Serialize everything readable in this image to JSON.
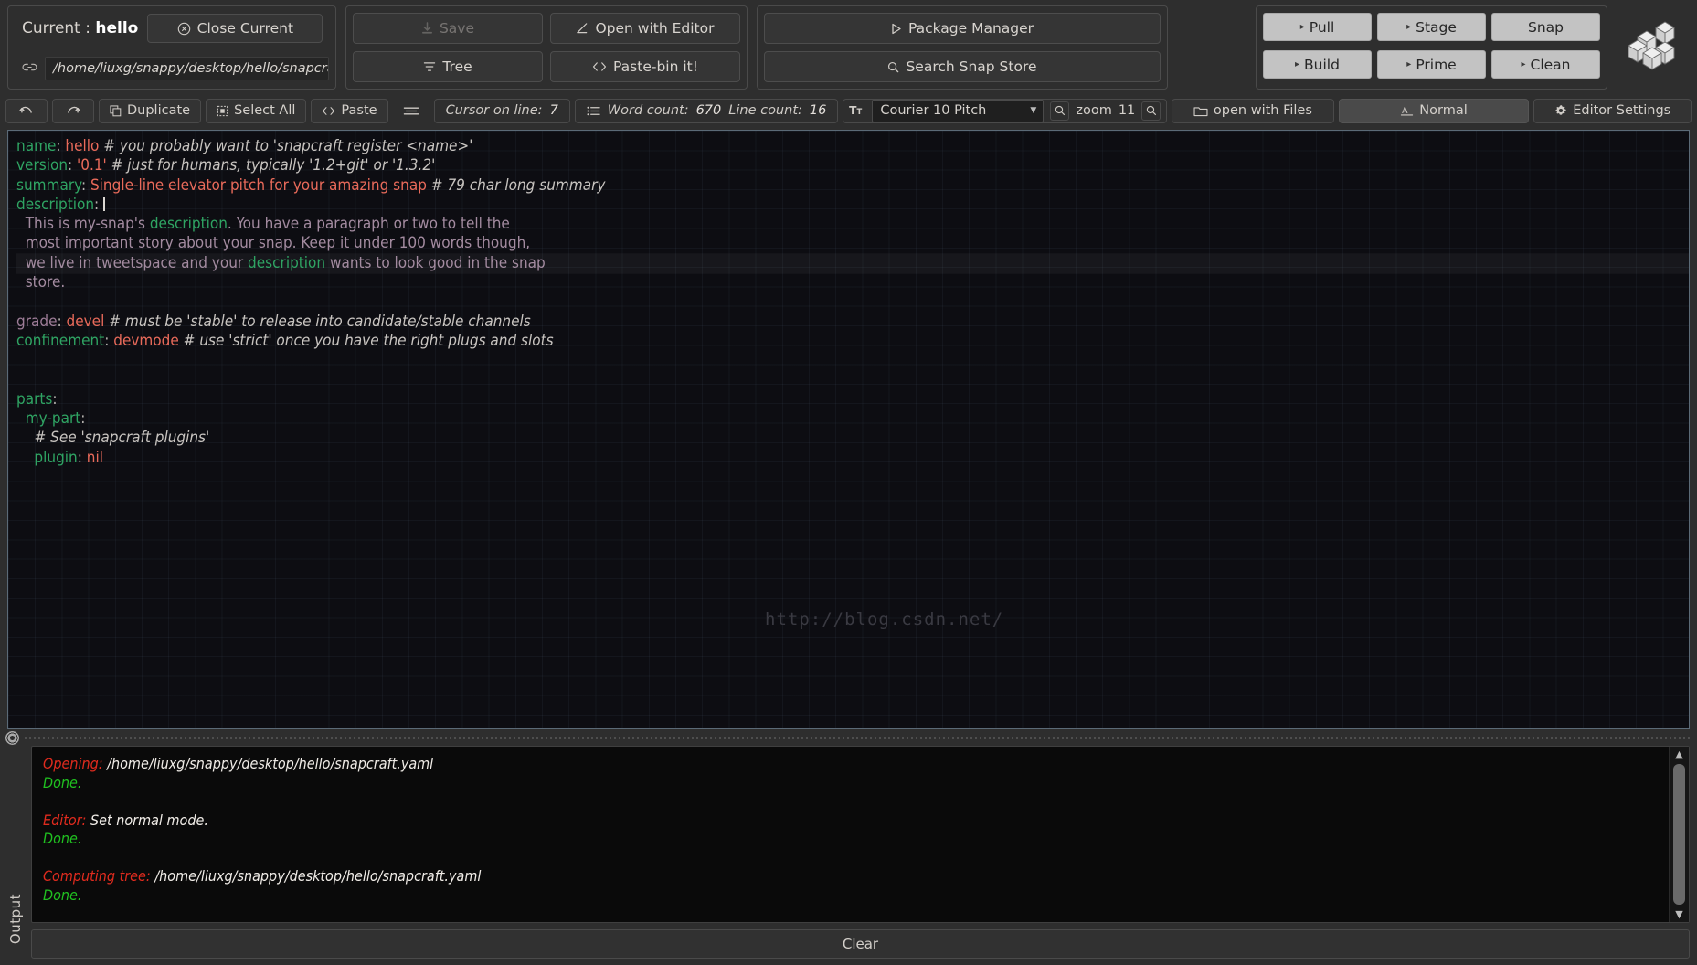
{
  "current": {
    "label_prefix": "Current : ",
    "project_name": "hello",
    "close_label": "Close Current",
    "close_icon": "close-circle-icon",
    "link_icon": "link-icon",
    "path_value": "/home/liuxg/snappy/desktop/hello/snapcraft.yaml"
  },
  "file_actions": [
    {
      "label": "Save",
      "icon": "download-icon",
      "name": "save-button",
      "disabled": true
    },
    {
      "label": "Open with Editor",
      "icon": "pencil-icon",
      "name": "open-editor-button",
      "disabled": false
    },
    {
      "label": "Tree",
      "icon": "tree-icon",
      "name": "tree-button",
      "disabled": false
    },
    {
      "label": "Paste-bin it!",
      "icon": "code-icon",
      "name": "pastebin-button",
      "disabled": false
    }
  ],
  "store_actions": [
    {
      "label": "Package Manager",
      "icon": "play-icon",
      "name": "package-manager-button"
    },
    {
      "label": "Search Snap Store",
      "icon": "search-icon",
      "name": "search-snap-store-button"
    }
  ],
  "lifecycle": [
    {
      "label": "Pull",
      "name": "pull-button",
      "arrow": true
    },
    {
      "label": "Stage",
      "name": "stage-button",
      "arrow": true
    },
    {
      "label": "Snap",
      "name": "snap-button",
      "arrow": false
    },
    {
      "label": "Build",
      "name": "build-button",
      "arrow": true
    },
    {
      "label": "Prime",
      "name": "prime-button",
      "arrow": true
    },
    {
      "label": "Clean",
      "name": "clean-button",
      "arrow": true
    }
  ],
  "logo": {
    "name": "snapcraft-cube-logo"
  },
  "subbar": {
    "undo_icon": "undo-icon",
    "redo_icon": "redo-icon",
    "duplicate_label": "Duplicate",
    "select_all_label": "Select All",
    "paste_label": "Paste",
    "lines_icon": "align-lines-icon",
    "cursor_label": "Cursor on line:",
    "cursor_value": "7",
    "wordcount_icon": "list-icon",
    "wordcount_label": "Word count:",
    "wordcount_value": "670",
    "linecount_label": "Line count:",
    "linecount_value": "16",
    "font_icon": "font-size-icon",
    "font_value": "Courier 10 Pitch",
    "zoom_label": "zoom",
    "zoom_value": "11",
    "open_files_label": "open with Files",
    "open_files_icon": "folder-icon",
    "mode_label": "Normal",
    "mode_icon": "text-mode-icon",
    "settings_label": "Editor Settings",
    "settings_icon": "gear-icon"
  },
  "editor": {
    "watermark": "http://blog.csdn.net/",
    "current_line_index": 6,
    "lines": [
      [
        {
          "t": "name",
          "c": "k"
        },
        {
          "t": ":",
          "c": "p"
        },
        {
          "t": " hello ",
          "c": "v"
        },
        {
          "t": "# you probably want to 'snapcraft register <name>'",
          "c": "c"
        }
      ],
      [
        {
          "t": "version",
          "c": "k"
        },
        {
          "t": ":",
          "c": "p"
        },
        {
          "t": " '0.1' ",
          "c": "v"
        },
        {
          "t": "# just for humans, typically '1.2+git' or '1.3.2'",
          "c": "c"
        }
      ],
      [
        {
          "t": "summary",
          "c": "k"
        },
        {
          "t": ":",
          "c": "p"
        },
        {
          "t": " Single-line elevator pitch for your amazing snap ",
          "c": "v"
        },
        {
          "t": "# 79 char long summary",
          "c": "c"
        }
      ],
      [
        {
          "t": "description",
          "c": "k"
        },
        {
          "t": ": ",
          "c": "p"
        },
        {
          "t": "|CARET|",
          "c": "caret"
        }
      ],
      [
        {
          "t": "  This is my-snap's ",
          "c": "t"
        },
        {
          "t": "description",
          "c": "k"
        },
        {
          "t": ". You have a paragraph or two to tell the",
          "c": "t"
        }
      ],
      [
        {
          "t": "  most important story about your snap. Keep it under 100 words though,",
          "c": "t"
        }
      ],
      [
        {
          "t": "  we live in tweetspace and your ",
          "c": "t"
        },
        {
          "t": "description",
          "c": "k"
        },
        {
          "t": " wants to look good in the snap",
          "c": "t"
        }
      ],
      [
        {
          "t": "  store.",
          "c": "t"
        }
      ],
      [
        {
          "t": "",
          "c": "t"
        }
      ],
      [
        {
          "t": "grade",
          "c": "kp"
        },
        {
          "t": ":",
          "c": "p"
        },
        {
          "t": " devel ",
          "c": "v"
        },
        {
          "t": "# must be 'stable' to release into candidate/stable channels",
          "c": "c"
        }
      ],
      [
        {
          "t": "confinement",
          "c": "k"
        },
        {
          "t": ":",
          "c": "p"
        },
        {
          "t": " devmode ",
          "c": "v"
        },
        {
          "t": "# use 'strict' once you have the right plugs and slots",
          "c": "c"
        }
      ],
      [
        {
          "t": "",
          "c": "t"
        }
      ],
      [
        {
          "t": "",
          "c": "t"
        }
      ],
      [
        {
          "t": "parts",
          "c": "k"
        },
        {
          "t": ":",
          "c": "p"
        }
      ],
      [
        {
          "t": "  my-part",
          "c": "k"
        },
        {
          "t": ":",
          "c": "p"
        }
      ],
      [
        {
          "t": "    ",
          "c": "t"
        },
        {
          "t": "# See 'snapcraft plugins'",
          "c": "c"
        }
      ],
      [
        {
          "t": "    plugin",
          "c": "k"
        },
        {
          "t": ":",
          "c": "p"
        },
        {
          "t": " nil",
          "c": "v"
        }
      ]
    ]
  },
  "output": {
    "tab_label": "Output",
    "handle_icon": "resize-handle-icon",
    "scroll_up_icon": "chevron-up-icon",
    "scroll_down_icon": "chevron-down-icon",
    "clear_label": "Clear",
    "lines": [
      [
        {
          "t": "Opening:",
          "c": "o-red"
        },
        {
          "t": " /home/liuxg/snappy/desktop/hello/snapcraft.yaml",
          "c": "o-white"
        }
      ],
      [
        {
          "t": "Done.",
          "c": "o-green"
        }
      ],
      [],
      [
        {
          "t": "Editor:",
          "c": "o-red"
        },
        {
          "t": " Set normal mode.",
          "c": "o-white"
        }
      ],
      [
        {
          "t": "Done.",
          "c": "o-green"
        }
      ],
      [],
      [
        {
          "t": "Computing tree:",
          "c": "o-red"
        },
        {
          "t": " /home/liuxg/snappy/desktop/hello/snapcraft.yaml",
          "c": "o-white"
        }
      ],
      [
        {
          "t": "Done.",
          "c": "o-green"
        }
      ]
    ]
  }
}
